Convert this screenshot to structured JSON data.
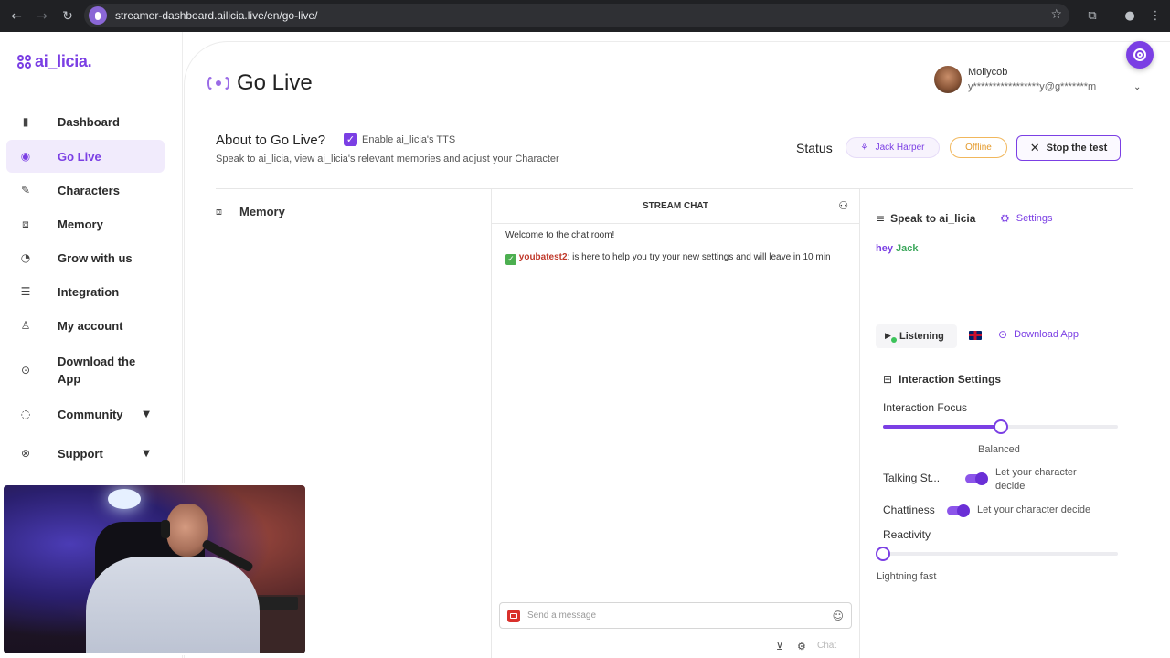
{
  "browser": {
    "url": "streamer-dashboard.ailicia.live/en/go-live/"
  },
  "sidebar": {
    "logo": "ai_licia.",
    "items": [
      {
        "label": "Dashboard"
      },
      {
        "label": "Go Live"
      },
      {
        "label": "Characters"
      },
      {
        "label": "Memory"
      },
      {
        "label": "Grow with us"
      },
      {
        "label": "Integration"
      },
      {
        "label": "My account"
      },
      {
        "label": "Download the App"
      },
      {
        "label": "Community"
      },
      {
        "label": "Support"
      }
    ]
  },
  "header": {
    "title": "Go Live",
    "user_name": "Mollycob",
    "user_email": "y*****************y@g*******m"
  },
  "about": {
    "title": "About to Go Live?",
    "tts_label": "Enable ai_licia's TTS",
    "tts_checked": true,
    "subtitle": "Speak to ai_licia, view ai_licia's relevant memories and adjust your Character"
  },
  "status": {
    "label": "Status",
    "character": "Jack Harper",
    "state": "Offline",
    "stop_button": "Stop the test"
  },
  "memory": {
    "label": "Memory"
  },
  "chat": {
    "title": "STREAM CHAT",
    "welcome": "Welcome to the chat room!",
    "message_user": "youbatest2",
    "message_text": ": is here to help you try your new settings and will leave in 10 min",
    "placeholder": "Send a message",
    "send_label": "Chat"
  },
  "speak": {
    "title": "Speak to ai_licia",
    "settings_label": "Settings",
    "text_prefix": "hey",
    "text_name": "Jack",
    "listening_label": "Listening",
    "download_label": "Download App"
  },
  "interaction": {
    "title": "Interaction Settings",
    "focus_label": "Interaction Focus",
    "focus_value": 0.5,
    "focus_caption": "Balanced",
    "talking_label": "Talking St...",
    "talking_toggle_on": true,
    "talking_desc": "Let your character decide",
    "chattiness_label": "Chattiness",
    "chattiness_toggle_on": true,
    "chattiness_desc": "Let your character decide",
    "reactivity_label": "Reactivity",
    "reactivity_value": 0,
    "reactivity_caption": "Lightning fast"
  },
  "colors": {
    "accent": "#7b3fe4",
    "offline": "#e49a2b",
    "listening_dot": "#3cc35a"
  }
}
